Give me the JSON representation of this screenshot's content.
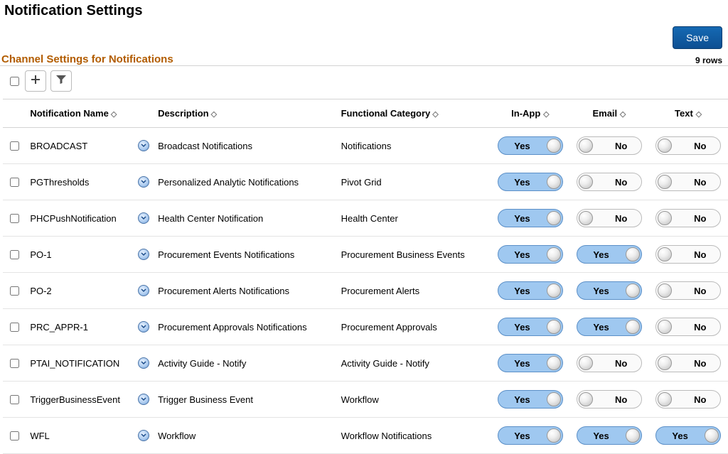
{
  "page": {
    "title": "Notification Settings",
    "save_label": "Save"
  },
  "section": {
    "title": "Channel Settings for Notifications",
    "row_count_label": "9 rows"
  },
  "toolbar": {
    "add_icon": "plus-icon",
    "filter_icon": "funnel-icon"
  },
  "columns": {
    "name": "Notification Name",
    "description": "Description",
    "category": "Functional Category",
    "inapp": "In-App",
    "email": "Email",
    "text": "Text"
  },
  "toggle_labels": {
    "yes": "Yes",
    "no": "No"
  },
  "rows": [
    {
      "name": "BROADCAST",
      "desc": "Broadcast Notifications",
      "cat": "Notifications",
      "inapp": true,
      "email": false,
      "text": false
    },
    {
      "name": "PGThresholds",
      "desc": "Personalized Analytic Notifications",
      "cat": "Pivot Grid",
      "inapp": true,
      "email": false,
      "text": false
    },
    {
      "name": "PHCPushNotification",
      "desc": "Health Center Notification",
      "cat": "Health Center",
      "inapp": true,
      "email": false,
      "text": false
    },
    {
      "name": "PO-1",
      "desc": "Procurement Events Notifications",
      "cat": "Procurement Business Events",
      "inapp": true,
      "email": true,
      "text": false
    },
    {
      "name": "PO-2",
      "desc": "Procurement Alerts Notifications",
      "cat": "Procurement Alerts",
      "inapp": true,
      "email": true,
      "text": false
    },
    {
      "name": "PRC_APPR-1",
      "desc": "Procurement Approvals Notifications",
      "cat": "Procurement Approvals",
      "inapp": true,
      "email": true,
      "text": false
    },
    {
      "name": "PTAI_NOTIFICATION",
      "desc": "Activity Guide - Notify",
      "cat": "Activity Guide - Notify",
      "inapp": true,
      "email": false,
      "text": false
    },
    {
      "name": "TriggerBusinessEvent",
      "desc": "Trigger Business Event",
      "cat": "Workflow",
      "inapp": true,
      "email": false,
      "text": false
    },
    {
      "name": "WFL",
      "desc": "Workflow",
      "cat": "Workflow Notifications",
      "inapp": true,
      "email": true,
      "text": true
    }
  ]
}
